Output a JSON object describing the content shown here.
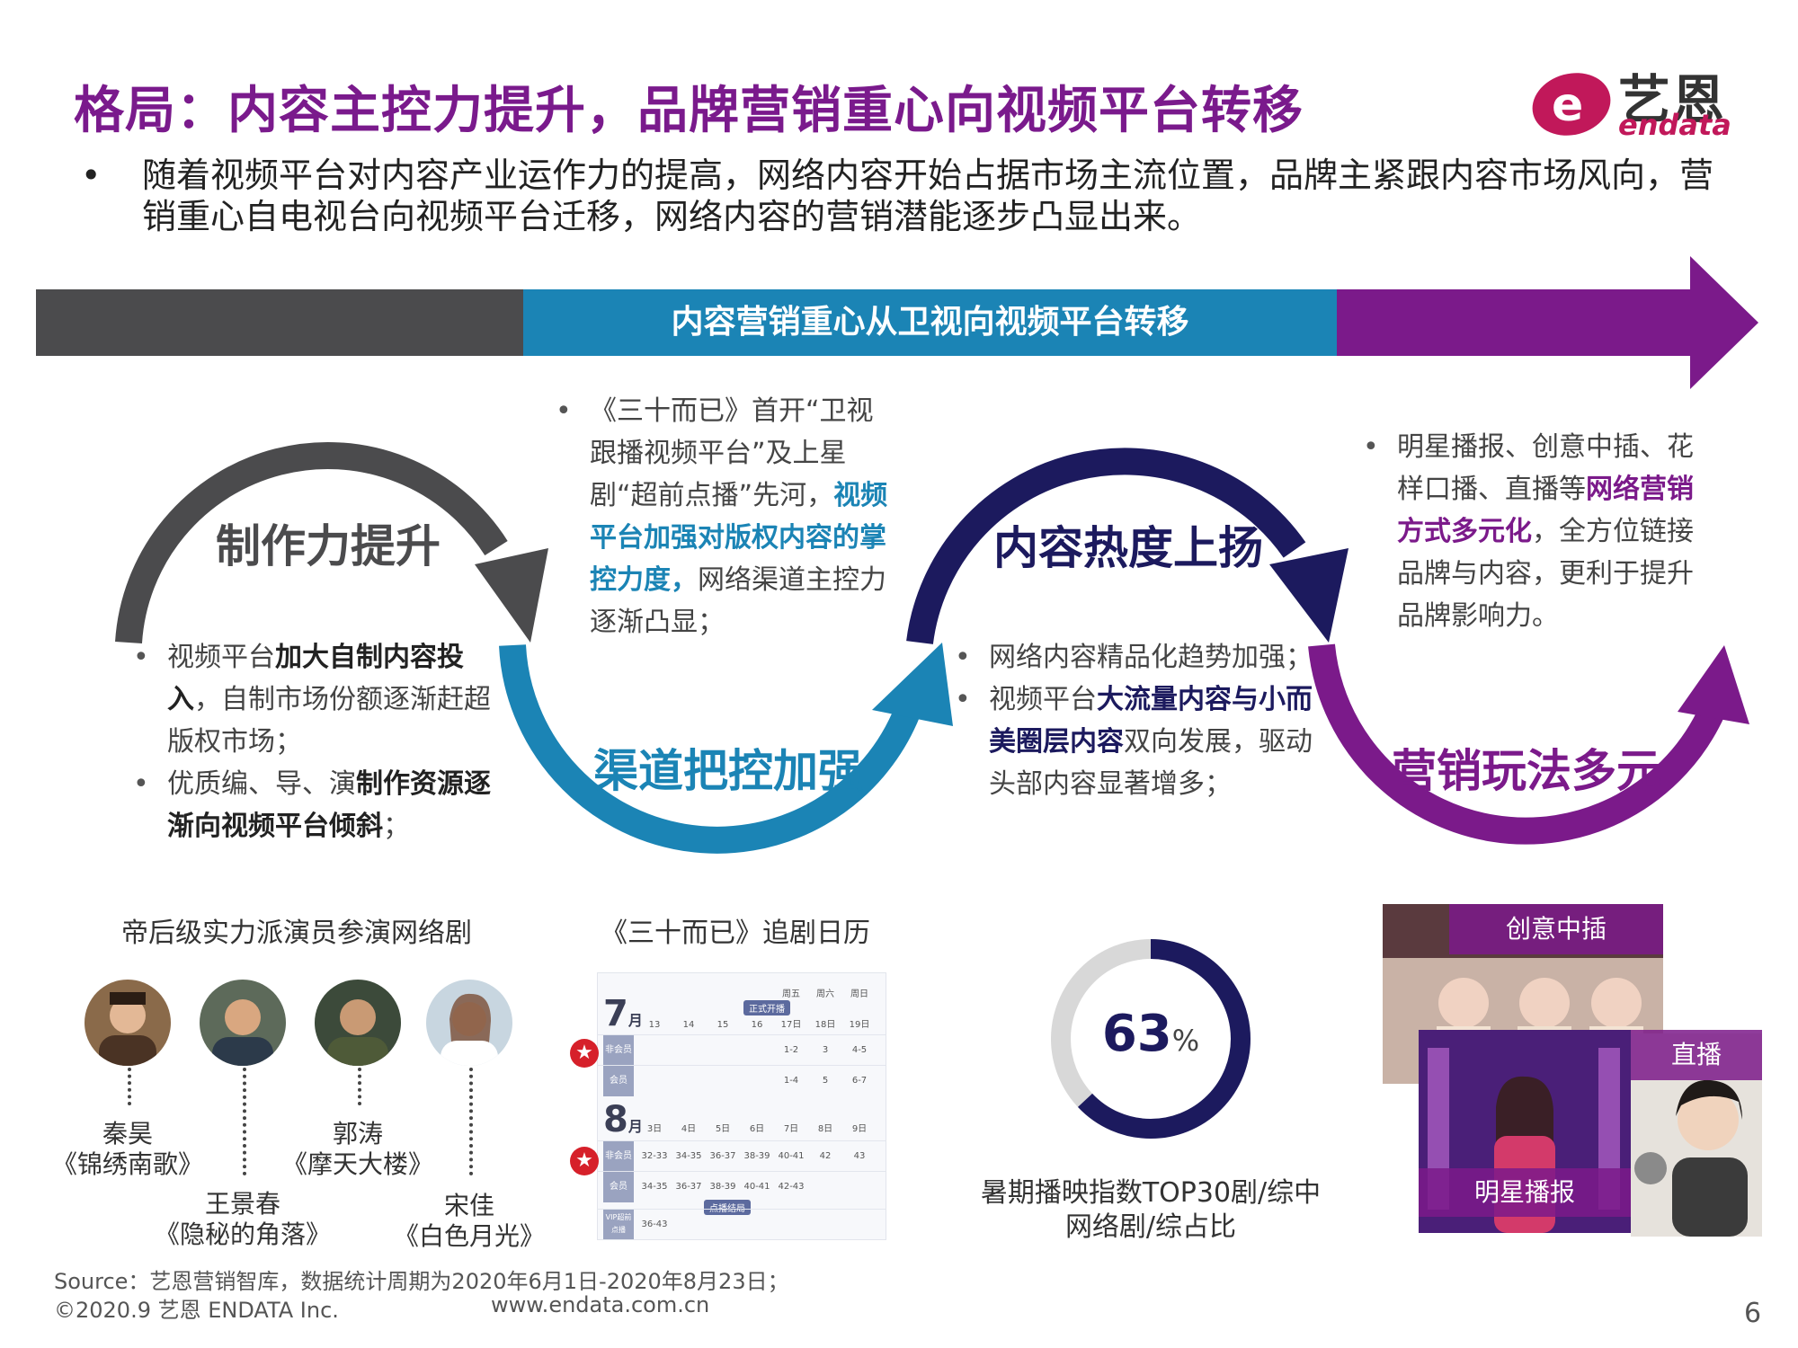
{
  "title": "格局：内容主控力提升，品牌营销重心向视频平台转移",
  "logo": {
    "cn": "艺恩",
    "en": "endata"
  },
  "summary": "随着视频平台对内容产业运作力的提高，网络内容开始占据市场主流位置，品牌主紧跟内容市场风向，营销重心自电视台向视频平台迁移，网络内容的营销潜能逐步凸显出来。",
  "band": {
    "text": "内容营销重心从卫视向视频平台转移"
  },
  "colors": {
    "title": "#7a1a8c",
    "gray": "#4b4b4d",
    "blue": "#1b84b5",
    "navy": "#1c1a5e",
    "purple": "#7b1a8a"
  },
  "stages": {
    "s1": {
      "label": "制作力提升"
    },
    "s2": {
      "label": "渠道把控加强"
    },
    "s3": {
      "label": "内容热度上扬"
    },
    "s4": {
      "label": "营销玩法多元"
    }
  },
  "desc1": {
    "b1a": "视频平台",
    "b1b": "加大自制内容投入",
    "b1c": "，自制市场份额逐渐赶超版权市场；",
    "b2a": "优质编、导、演",
    "b2b": "制作资源逐渐向视频平台倾斜",
    "b2c": "；"
  },
  "desc2": {
    "a": "《三十而已》首开“卫视跟播视频平台”及上星剧“超前点播”先河，",
    "b": "视频平台加强对版权内容的掌控力度，",
    "c": "网络渠道主控力逐渐凸显；"
  },
  "desc3": {
    "b1": "网络内容精品化趋势加强；",
    "b2a": "视频平台",
    "b2b": "大流量内容与小而美圈层内容",
    "b2c": "双向发展，驱动头部内容显著增多；"
  },
  "desc4": {
    "a": "明星播报、创意中插、花样口播、直播等",
    "b": "网络营销方式多元化",
    "c": "，全方位链接品牌与内容，更利于提升品牌影响力。"
  },
  "actors": {
    "caption": "帝后级实力派演员参演网络剧",
    "list": [
      {
        "name": "秦昊",
        "show": "《锦绣南歌》"
      },
      {
        "name": "王景春",
        "show": "《隐秘的角落》"
      },
      {
        "name": "郭涛",
        "show": "《摩天大楼》"
      },
      {
        "name": "宋佳",
        "show": "《白色月光》"
      }
    ]
  },
  "calendar": {
    "caption": "《三十而已》追剧日历",
    "july": {
      "month": "7",
      "unit": "月",
      "weekdays": [
        "周五",
        "周六",
        "周日"
      ],
      "dates": [
        "13",
        "14",
        "15",
        "16",
        "17日",
        "18日",
        "19日"
      ],
      "tag": "正式开播",
      "rows": [
        {
          "label": "非会员",
          "cells": [
            "",
            "",
            "",
            "",
            "1-2",
            "3",
            "4-5"
          ]
        },
        {
          "label": "会员",
          "cells": [
            "",
            "",
            "",
            "",
            "1-4",
            "5",
            "6-7"
          ]
        }
      ]
    },
    "aug": {
      "month": "8",
      "unit": "月",
      "dates": [
        "3日",
        "4日",
        "5日",
        "6日",
        "7日",
        "8日",
        "9日"
      ],
      "tag": "点播结局",
      "rows": [
        {
          "label": "非会员",
          "cells": [
            "32-33",
            "34-35",
            "36-37",
            "38-39",
            "40-41",
            "42",
            "43"
          ]
        },
        {
          "label": "会员",
          "cells": [
            "34-35",
            "36-37",
            "38-39",
            "40-41",
            "42-43",
            "",
            ""
          ]
        },
        {
          "label": "VIP超前点播",
          "cells": [
            "36-43",
            "",
            "",
            "",
            "",
            "",
            ""
          ]
        }
      ]
    }
  },
  "donut": {
    "value": 63,
    "value_text": "63",
    "unit": "%",
    "caption_l1": "暑期播映指数TOP30剧/综中",
    "caption_l2": "网络剧/综占比"
  },
  "photos": {
    "top": "创意中插",
    "right": "直播",
    "bottom": "明星播报"
  },
  "footer": {
    "source": "Source：艺恩营销智库，数据统计周期为2020年6月1日-2020年8月23日；",
    "copyright": "©2020.9 艺恩 ENDATA Inc.",
    "url": "www.endata.com.cn",
    "page": "6"
  }
}
